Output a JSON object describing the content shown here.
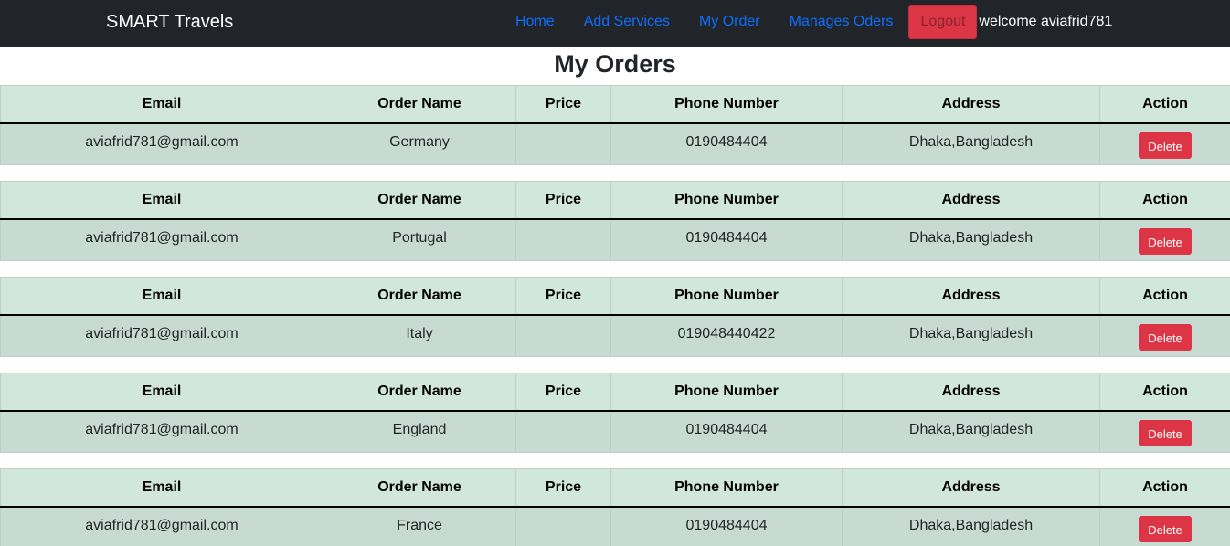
{
  "nav": {
    "brand": "SMART Travels",
    "links": [
      "Home",
      "Add Services",
      "My Order",
      "Manages Oders"
    ],
    "logout_label": "Logout",
    "welcome_text": "welcome aviafrid781"
  },
  "page": {
    "title": "My Orders"
  },
  "columns": [
    "Email",
    "Order Name",
    "Price",
    "Phone Number",
    "Address",
    "Action"
  ],
  "orders": [
    {
      "email": "aviafrid781@gmail.com",
      "order_name": "Germany",
      "price": "",
      "phone": "0190484404",
      "address": "Dhaka,Bangladesh",
      "action_label": "Delete"
    },
    {
      "email": "aviafrid781@gmail.com",
      "order_name": "Portugal",
      "price": "",
      "phone": "0190484404",
      "address": "Dhaka,Bangladesh",
      "action_label": "Delete"
    },
    {
      "email": "aviafrid781@gmail.com",
      "order_name": "Italy",
      "price": "",
      "phone": "019048440422",
      "address": "Dhaka,Bangladesh",
      "action_label": "Delete"
    },
    {
      "email": "aviafrid781@gmail.com",
      "order_name": "England",
      "price": "",
      "phone": "0190484404",
      "address": "Dhaka,Bangladesh",
      "action_label": "Delete"
    },
    {
      "email": "aviafrid781@gmail.com",
      "order_name": "France",
      "price": "",
      "phone": "0190484404",
      "address": "Dhaka,Bangladesh",
      "action_label": "Delete"
    }
  ],
  "colors": {
    "navbar_bg": "#212529",
    "link": "#0d6efd",
    "danger": "#dc3545",
    "table_header_bg": "#d1e7dd",
    "table_row_bg": "#c7dbd2"
  }
}
